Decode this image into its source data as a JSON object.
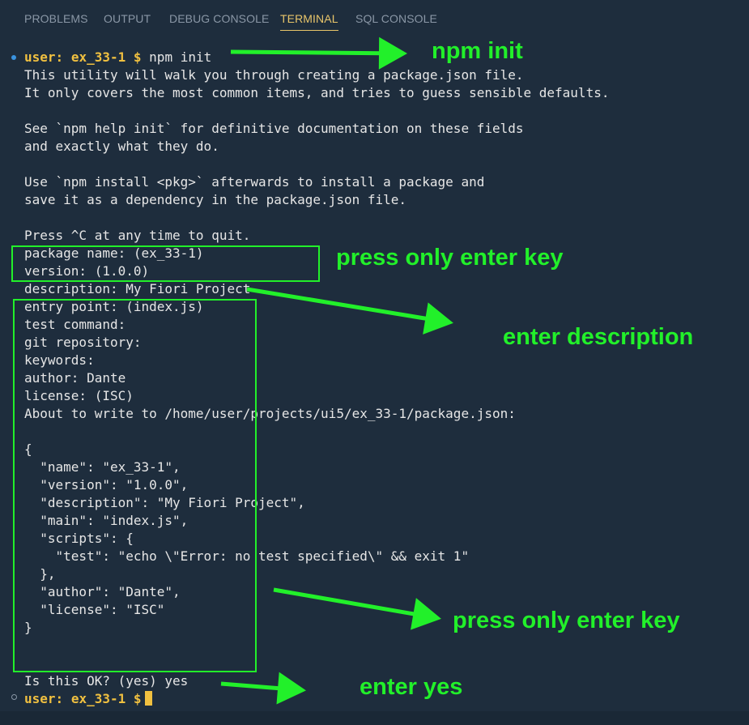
{
  "tabs": [
    {
      "label": "PROBLEMS"
    },
    {
      "label": "OUTPUT"
    },
    {
      "label": "DEBUG CONSOLE"
    },
    {
      "label": "TERMINAL"
    },
    {
      "label": "SQL CONSOLE"
    }
  ],
  "active_tab": "TERMINAL",
  "prompt": {
    "user": "user:",
    "cwd": "ex_33-1",
    "symbol": "$",
    "command": "npm init"
  },
  "lines": [
    "This utility will walk you through creating a package.json file.",
    "It only covers the most common items, and tries to guess sensible defaults.",
    "",
    "See `npm help init` for definitive documentation on these fields",
    "and exactly what they do.",
    "",
    "Use `npm install <pkg>` afterwards to install a package and",
    "save it as a dependency in the package.json file.",
    "",
    "Press ^C at any time to quit.",
    "package name: (ex_33-1)",
    "version: (1.0.0)",
    "description: My Fiori Project",
    "entry point: (index.js)",
    "test command:",
    "git repository:",
    "keywords:",
    "author: Dante",
    "license: (ISC)",
    "About to write to /home/user/projects/ui5/ex_33-1/package.json:",
    "",
    "{",
    "  \"name\": \"ex_33-1\",",
    "  \"version\": \"1.0.0\",",
    "  \"description\": \"My Fiori Project\",",
    "  \"main\": \"index.js\",",
    "  \"scripts\": {",
    "    \"test\": \"echo \\\"Error: no test specified\\\" && exit 1\"",
    "  },",
    "  \"author\": \"Dante\",",
    "  \"license\": \"ISC\"",
    "}",
    "",
    "",
    "Is this OK? (yes) yes"
  ],
  "annotations": {
    "npm_init": "npm init",
    "press_enter_1": "press only enter key",
    "enter_description": "enter description",
    "press_enter_2": "press only enter key",
    "enter_yes": "enter yes"
  },
  "colors": {
    "background": "#1e2d3d",
    "prompt": "#f0c040",
    "annotation": "#22f02a",
    "active_tab": "#e8c56a"
  }
}
